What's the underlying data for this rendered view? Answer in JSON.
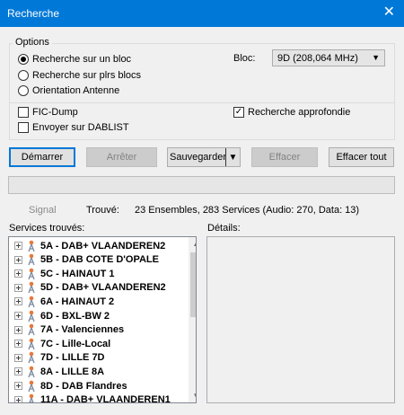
{
  "window": {
    "title": "Recherche",
    "close_glyph": "✕"
  },
  "options": {
    "legend": "Options",
    "radios": [
      {
        "label": "Recherche sur un bloc",
        "selected": true
      },
      {
        "label": "Recherche sur plrs blocs",
        "selected": false
      },
      {
        "label": "Orientation Antenne",
        "selected": false
      }
    ],
    "bloc_label": "Bloc:",
    "bloc_value": "9D (208,064 MHz)",
    "checkboxes": [
      {
        "label": "FIC-Dump",
        "checked": false
      },
      {
        "label": "Envoyer sur DABLIST",
        "checked": false
      },
      {
        "label": "Recherche approfondie",
        "checked": true
      }
    ]
  },
  "buttons": {
    "start": "Démarrer",
    "stop": "Arrêter",
    "save": "Sauvegarder",
    "clear": "Effacer",
    "clear_all": "Effacer tout"
  },
  "status": {
    "signal_label": "Signal",
    "found_label": "Trouvé:",
    "found_value": "23 Ensembles, 283 Services (Audio: 270, Data: 13)"
  },
  "services": {
    "label": "Services trouvés:",
    "items": [
      "5A - DAB+ VLAANDEREN2",
      "5B - DAB COTE D'OPALE",
      "5C - HAINAUT 1",
      "5D - DAB+ VLAANDEREN2",
      "6A - HAINAUT 2",
      "6D - BXL-BW 2",
      "7A - Valenciennes",
      "7C - Lille-Local",
      "7D - LILLE 7D",
      "8A - LILLE 8A",
      "8D - DAB Flandres",
      "11A - DAB+ VLAANDEREN1"
    ]
  },
  "details": {
    "label": "Détails:"
  },
  "icons": {
    "tree_item": "antenna-tower-icon"
  },
  "colors": {
    "titlebar": "#0078d7",
    "icon_orange": "#e8793a",
    "icon_gray": "#7a8aa0"
  }
}
